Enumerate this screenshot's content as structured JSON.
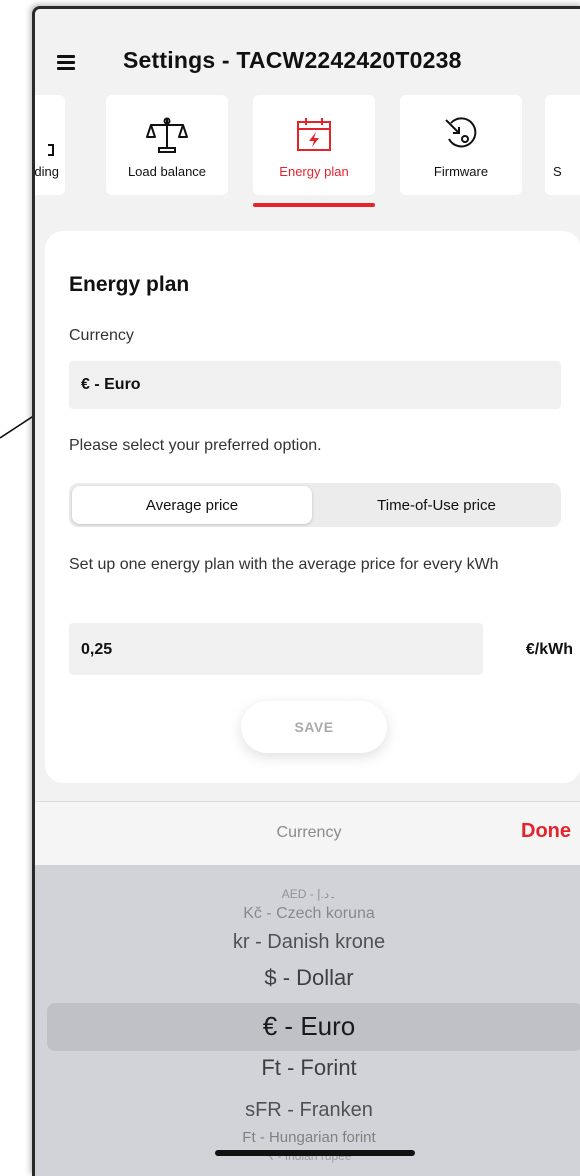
{
  "header": {
    "title": "Settings - TACW2242420T0238",
    "menu_icon": "hamburger-icon"
  },
  "tabs": [
    {
      "label": "ding",
      "icon": "partial-icon"
    },
    {
      "label": "Load balance",
      "icon": "scales-icon"
    },
    {
      "label": "Energy plan",
      "icon": "calendar-lightning-icon",
      "active": true
    },
    {
      "label": "Firmware",
      "icon": "firmware-update-icon"
    },
    {
      "label": "S",
      "icon": "partial-icon"
    }
  ],
  "card": {
    "title": "Energy plan",
    "currency_label": "Currency",
    "currency_value": "€ - Euro",
    "prompt": "Please select your preferred option.",
    "segment": {
      "option_a": "Average price",
      "option_b": "Time-of-Use price",
      "selected": "Average price"
    },
    "description": "Set up one energy plan with the average price for every kWh",
    "price_value": "0,25",
    "price_unit": "€/kWh",
    "save_label": "SAVE"
  },
  "picker": {
    "title": "Currency",
    "done_label": "Done",
    "items": [
      "AED - ۔د.إ",
      "Kč - Czech koruna",
      "kr - Danish krone",
      "$ - Dollar",
      "€ - Euro",
      "Ft - Forint",
      "sFR - Franken",
      "Ft - Hungarian forint",
      "₹ - Indian rupee"
    ],
    "selected": "€ - Euro"
  },
  "colors": {
    "accent": "#e3242b",
    "background": "#f2f2f2",
    "picker_bg": "#d1d3d9"
  }
}
